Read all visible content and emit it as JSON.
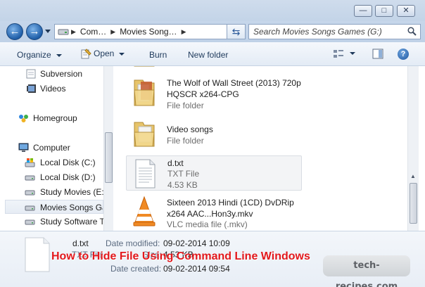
{
  "window_controls": {
    "minimize": "—",
    "maximize": "□",
    "close": "✕"
  },
  "address": {
    "crumbs": [
      "Com…",
      "Movies Song…"
    ],
    "search_placeholder": "Search Movies Songs Games (G:)"
  },
  "toolbar": {
    "organize": "Organize",
    "open": "Open",
    "burn": "Burn",
    "new_folder": "New folder"
  },
  "nav": {
    "items": [
      {
        "label": "Subversion",
        "icon": "folder-icon"
      },
      {
        "label": "Videos",
        "icon": "videos-library-icon"
      },
      {
        "label": "Homegroup",
        "icon": "homegroup-icon"
      },
      {
        "label": "Computer",
        "icon": "computer-icon"
      },
      {
        "label": "Local Disk (C:)",
        "icon": "windows-drive-icon"
      },
      {
        "label": "Local Disk (D:)",
        "icon": "drive-icon"
      },
      {
        "label": "Study Movies (E:)",
        "icon": "drive-icon"
      },
      {
        "label": "Movies Songs Games (G:)",
        "icon": "drive-icon",
        "selected": true
      },
      {
        "label": "Study Software T",
        "icon": "drive-icon"
      }
    ]
  },
  "files": [
    {
      "name_line1": "The Wolf of Wall Street (2013) 720p",
      "name_line2": "HQSCR x264-CPG",
      "type": "File folder",
      "icon": "folder-icon"
    },
    {
      "name_line1": "Video songs",
      "name_line2": "",
      "type": "File folder",
      "icon": "folder-icon"
    },
    {
      "name_line1": "d.txt",
      "name_line2": "",
      "type": "TXT File",
      "size": "4.53 KB",
      "icon": "text-file-icon",
      "selected": true
    },
    {
      "name_line1": "Sixteen 2013 Hindi (1CD) DvDRip",
      "name_line2": "x264 AAC...Hon3y.mkv",
      "type": "VLC media file (.mkv)",
      "icon": "vlc-icon"
    }
  ],
  "details": {
    "name": "d.txt",
    "type": "TXT File",
    "date_modified_label": "Date modified:",
    "date_modified": "09-02-2014 10:09",
    "size_label": "Size:",
    "size": "4.53 KB",
    "date_created_label": "Date created:",
    "date_created": "09-02-2014 09:54"
  },
  "overlay_title": "How to Hide File Using Command Line Windows",
  "watermark": "tech-recipes.com"
}
